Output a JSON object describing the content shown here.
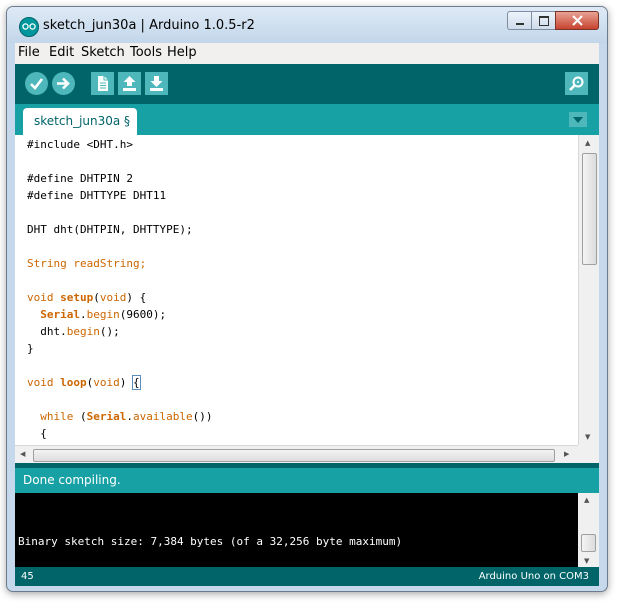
{
  "window": {
    "title": "sketch_jun30a | Arduino 1.0.5-r2"
  },
  "menu": {
    "items": [
      "File",
      "Edit",
      "Sketch",
      "Tools",
      "Help"
    ]
  },
  "toolbar": {
    "buttons": [
      "verify-icon",
      "upload-icon",
      "new-icon",
      "open-icon",
      "save-icon",
      "serial-monitor-icon"
    ]
  },
  "tabs": {
    "active_label": "sketch_jun30a §"
  },
  "editor": {
    "lines": [
      "#include <DHT.h>",
      "",
      "#define DHTPIN 2",
      "#define DHTTYPE DHT11",
      "",
      "DHT dht(DHTPIN, DHTTYPE);",
      "",
      "String readString;",
      "",
      "void setup(void) {",
      "  Serial.begin(9600);",
      "  dht.begin();",
      "}",
      "",
      "void loop(void) {",
      "",
      "  while (Serial.available())",
      "  {"
    ]
  },
  "status": {
    "message": "Done compiling."
  },
  "console": {
    "output": "Binary sketch size: 7,384 bytes (of a 32,256 byte maximum)"
  },
  "footer": {
    "line_number": "45",
    "board": "Arduino Uno on COM3"
  },
  "colors": {
    "teal_dark": "#006468",
    "teal": "#17a1a5",
    "button": "#4db7bb",
    "keyword": "#cc6600"
  }
}
